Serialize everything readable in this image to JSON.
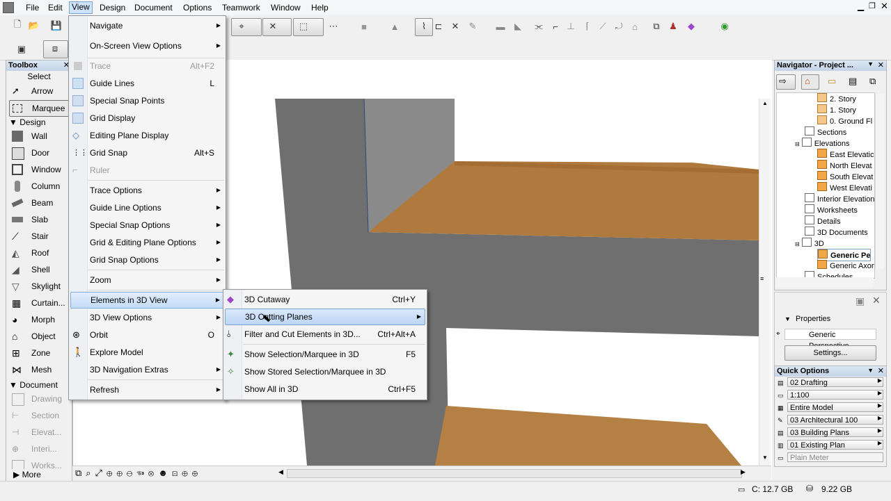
{
  "menubar": {
    "items": [
      {
        "label": "File"
      },
      {
        "label": "Edit"
      },
      {
        "label": "View"
      },
      {
        "label": "Design"
      },
      {
        "label": "Document"
      },
      {
        "label": "Options"
      },
      {
        "label": "Teamwork"
      },
      {
        "label": "Window"
      },
      {
        "label": "Help"
      }
    ]
  },
  "toolbox": {
    "title": "Toolbox",
    "select_label": "Select",
    "tools_select": [
      {
        "label": "Arrow"
      },
      {
        "label": "Marquee"
      }
    ],
    "design_header": "Design",
    "design_tools": [
      {
        "label": "Wall"
      },
      {
        "label": "Door"
      },
      {
        "label": "Window"
      },
      {
        "label": "Column"
      },
      {
        "label": "Beam"
      },
      {
        "label": "Slab"
      },
      {
        "label": "Stair"
      },
      {
        "label": "Roof"
      },
      {
        "label": "Shell"
      },
      {
        "label": "Skylight"
      },
      {
        "label": "Curtain..."
      },
      {
        "label": "Morph"
      },
      {
        "label": "Object"
      },
      {
        "label": "Zone"
      },
      {
        "label": "Mesh"
      }
    ],
    "document_header": "Document",
    "document_tools": [
      {
        "label": "Drawing"
      },
      {
        "label": "Section"
      },
      {
        "label": "Elevat..."
      },
      {
        "label": "Interi..."
      },
      {
        "label": "Works..."
      }
    ],
    "more_label": "More"
  },
  "view_menu": {
    "items": [
      {
        "label": "Navigate",
        "shortcut": ""
      },
      {
        "label": "On-Screen View Options",
        "shortcut": ""
      },
      {
        "label": "Trace",
        "shortcut": "Alt+F2"
      },
      {
        "label": "Guide Lines",
        "shortcut": "L"
      },
      {
        "label": "Special Snap Points",
        "shortcut": ""
      },
      {
        "label": "Grid Display",
        "shortcut": ""
      },
      {
        "label": "Editing Plane Display",
        "shortcut": ""
      },
      {
        "label": "Grid Snap",
        "shortcut": "Alt+S"
      },
      {
        "label": "Ruler",
        "shortcut": ""
      },
      {
        "label": "Trace Options",
        "shortcut": ""
      },
      {
        "label": "Guide Line Options",
        "shortcut": ""
      },
      {
        "label": "Special Snap Options",
        "shortcut": ""
      },
      {
        "label": "Grid & Editing Plane Options",
        "shortcut": ""
      },
      {
        "label": "Grid Snap Options",
        "shortcut": ""
      },
      {
        "label": "Zoom",
        "shortcut": ""
      },
      {
        "label": "Elements in 3D View",
        "shortcut": ""
      },
      {
        "label": "3D View Options",
        "shortcut": ""
      },
      {
        "label": "Orbit",
        "shortcut": "O"
      },
      {
        "label": "Explore Model",
        "shortcut": ""
      },
      {
        "label": "3D Navigation Extras",
        "shortcut": ""
      },
      {
        "label": "Refresh",
        "shortcut": ""
      }
    ]
  },
  "submenu_3d": {
    "items": [
      {
        "label": "3D Cutaway",
        "shortcut": "Ctrl+Y"
      },
      {
        "label": "3D Cutting Planes",
        "shortcut": ""
      },
      {
        "label": "Filter and Cut Elements in 3D...",
        "shortcut": "Ctrl+Alt+A"
      },
      {
        "label": "Show Selection/Marquee in 3D",
        "shortcut": "F5"
      },
      {
        "label": "Show Stored Selection/Marquee in 3D",
        "shortcut": ""
      },
      {
        "label": "Show All in 3D",
        "shortcut": "Ctrl+F5"
      }
    ]
  },
  "navigator": {
    "title": "Navigator - Project ...",
    "tree": [
      {
        "label": "2. Story"
      },
      {
        "label": "1. Story"
      },
      {
        "label": "0. Ground Fl"
      },
      {
        "label": "Sections"
      },
      {
        "label": "Elevations"
      },
      {
        "label": "East Elevatic"
      },
      {
        "label": "North Elevat"
      },
      {
        "label": "South Elevat"
      },
      {
        "label": "West Elevati"
      },
      {
        "label": "Interior Elevation"
      },
      {
        "label": "Worksheets"
      },
      {
        "label": "Details"
      },
      {
        "label": "3D Documents"
      },
      {
        "label": "3D"
      },
      {
        "label": "Generic Pe"
      },
      {
        "label": "Generic Axon"
      },
      {
        "label": "Schedules"
      }
    ]
  },
  "properties": {
    "header": "Properties",
    "value": "Generic Perspective",
    "settings_label": "Settings..."
  },
  "quick_options": {
    "title": "Quick Options",
    "rows": [
      {
        "value": "02 Drafting"
      },
      {
        "value": "1:100"
      },
      {
        "value": "Entire Model"
      },
      {
        "value": "03 Architectural 100"
      },
      {
        "value": "03 Building Plans"
      },
      {
        "value": "01 Existing Plan"
      },
      {
        "value": "Plain Meter"
      }
    ]
  },
  "status": {
    "disk": "C: 12.7 GB",
    "memory": "9.22 GB"
  },
  "colors": {
    "menu_highlight": "#c4dcf7",
    "wood": "#b07a3e",
    "wall": "#707070"
  }
}
